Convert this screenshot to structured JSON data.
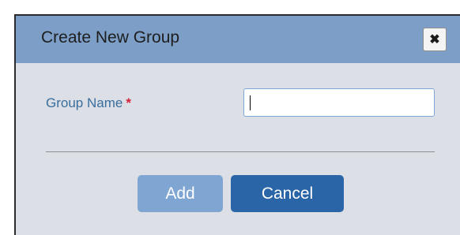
{
  "dialog": {
    "title": "Create New Group",
    "close_icon": "close-x-icon",
    "close_glyph": "✖"
  },
  "form": {
    "group_name_label": "Group Name",
    "required_marker": "*",
    "group_name_value": ""
  },
  "actions": {
    "add_label": "Add",
    "cancel_label": "Cancel"
  },
  "colors": {
    "titlebar": "#7c9ec7",
    "body": "#dcdfe5",
    "add_button": "#7fa6d3",
    "cancel_button": "#2a65a8",
    "label": "#3a6e9e",
    "required": "#d6213b"
  }
}
